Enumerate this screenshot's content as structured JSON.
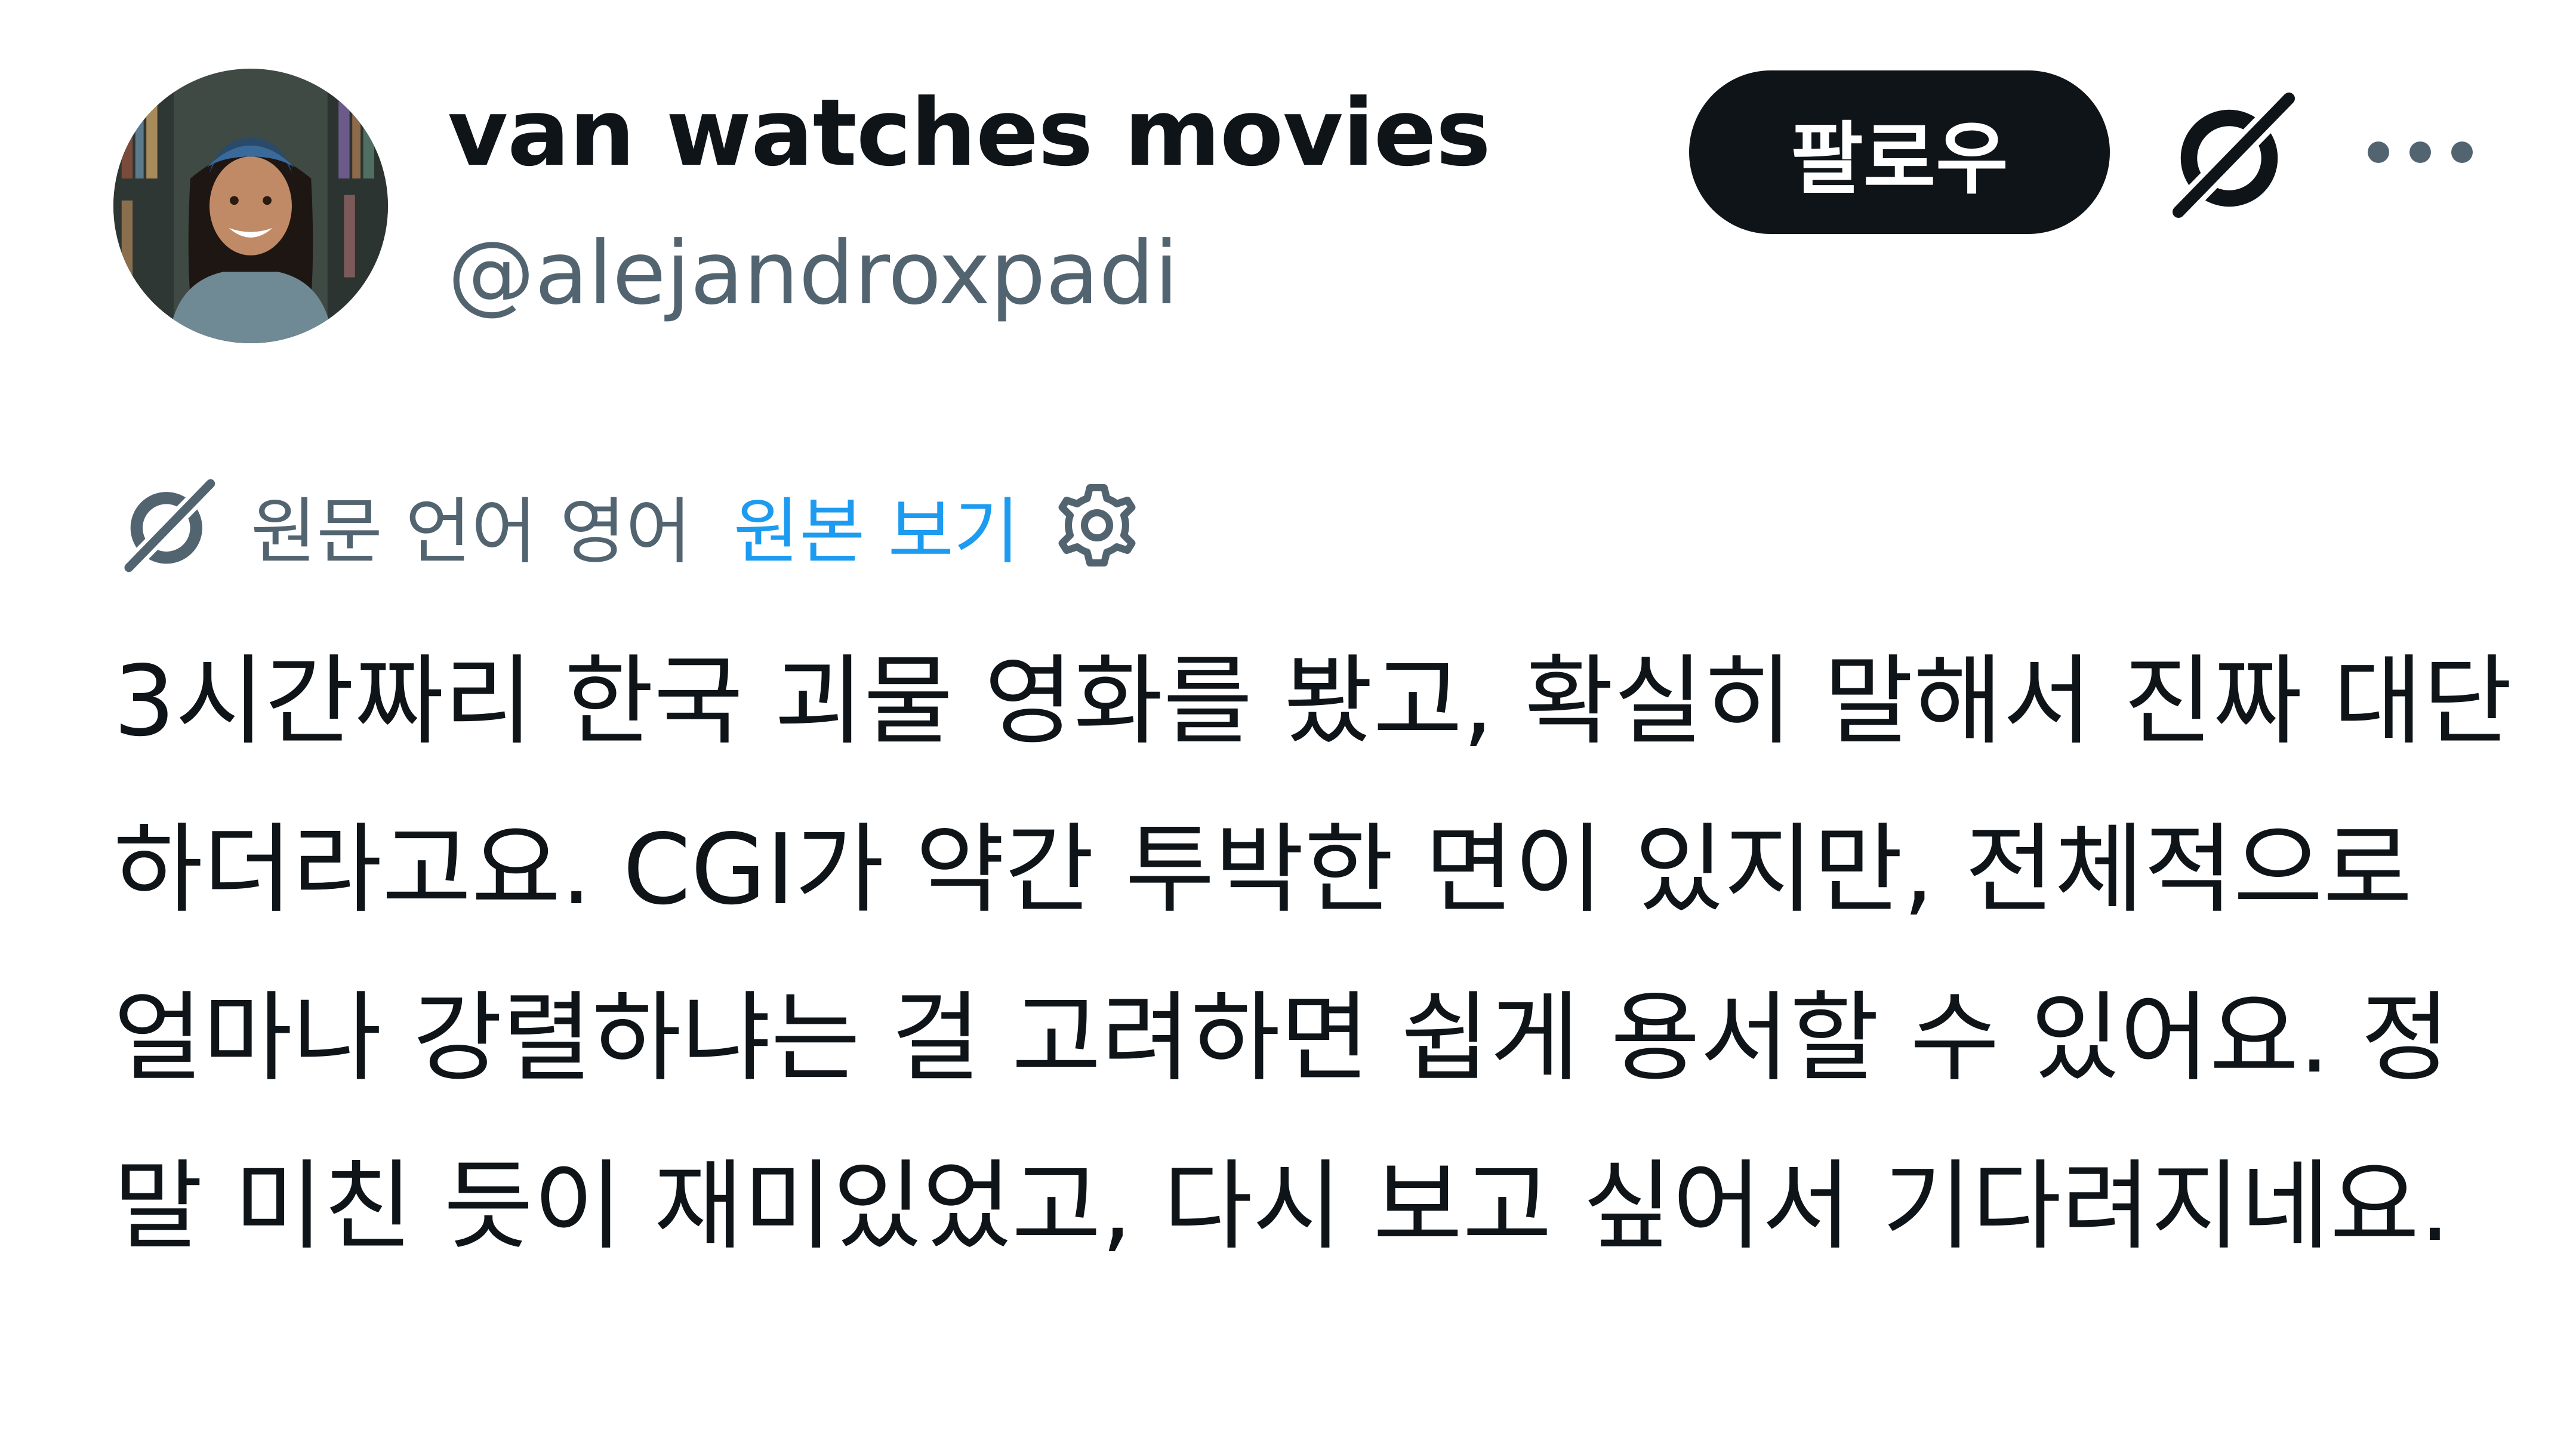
{
  "author": {
    "display_name": "van watches movies",
    "handle": "@alejandroxpadi"
  },
  "actions": {
    "follow_label": "팔로우",
    "grok_icon": "grok-icon",
    "more_icon": "more-icon"
  },
  "translation": {
    "icon": "grok-icon",
    "label": "원문 언어 영어",
    "view_original": "원본 보기",
    "settings_icon": "gear-icon"
  },
  "tweet": {
    "text": "3시간짜리 한국 괴물 영화를 봤고, 확실히 말해서 진짜 대단하더라고요. CGI가 약간 투박한 면이 있지만, 전체적으로 얼마나 강렬하냐는 걸 고려하면 쉽게 용서할 수 있어요. 정말 미친 듯이 재미있었고, 다시 보고 싶어서 기다려지네요."
  },
  "colors": {
    "text_primary": "#0f1419",
    "text_secondary": "#536471",
    "link": "#1d9bf0",
    "button_bg": "#0f1419"
  }
}
